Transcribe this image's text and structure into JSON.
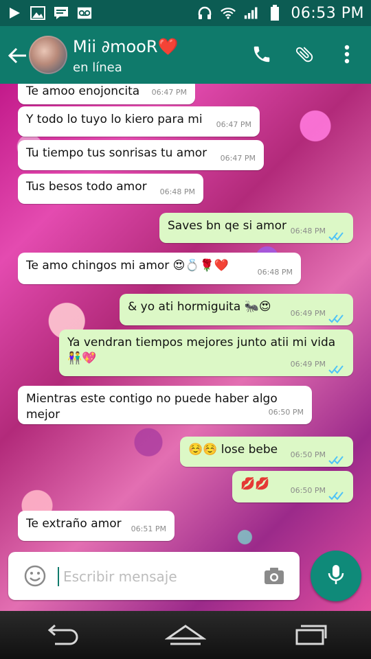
{
  "status_bar": {
    "time": "06:53 PM",
    "icons": [
      "play-icon",
      "image-icon",
      "message-icon",
      "voicemail-icon",
      "headphones-icon",
      "wifi-icon",
      "signal-icon",
      "battery-icon"
    ]
  },
  "header": {
    "contact_name": "Mii ∂mooR❤️",
    "status": "en línea",
    "icons": [
      "back-arrow-icon",
      "phone-icon",
      "attach-icon",
      "more-vert-icon"
    ]
  },
  "messages": [
    {
      "dir": "in",
      "text": "Te amoo enojoncita",
      "time": "06:47 PM"
    },
    {
      "dir": "in",
      "text": "Y todo lo tuyo lo kiero para mi",
      "time": "06:47 PM"
    },
    {
      "dir": "in",
      "text": "Tu tiempo tus sonrisas tu amor",
      "time": "06:47 PM"
    },
    {
      "dir": "in",
      "text": "Tus besos todo amor",
      "time": "06:48 PM"
    },
    {
      "dir": "out",
      "text": "Saves bn qe si amor",
      "time": "06:48 PM"
    },
    {
      "dir": "in",
      "text": "Te amo chingos mi amor 😍💍🌹❤️",
      "time": "06:48 PM"
    },
    {
      "dir": "out",
      "text": "& yo ati hormiguita 🐜😍",
      "time": "06:49 PM"
    },
    {
      "dir": "out",
      "text": "Ya vendran tiempos mejores junto atii mi vida 👫💖",
      "time": "06:49 PM"
    },
    {
      "dir": "in",
      "text": "Mientras este contigo no puede haber algo mejor",
      "time": "06:50 PM"
    },
    {
      "dir": "out",
      "text": "☺️☺️ lose bebe",
      "time": "06:50 PM"
    },
    {
      "dir": "out",
      "text": "💋💋",
      "time": "06:50 PM"
    },
    {
      "dir": "in",
      "text": "Te extraño amor",
      "time": "06:51 PM"
    }
  ],
  "composer": {
    "placeholder": "Escribir mensaje"
  },
  "colors": {
    "status_bar": "#0c5c53",
    "app_bar": "#0f7a6b",
    "outgoing_bubble": "#dcf8c6",
    "incoming_bubble": "#ffffff",
    "read_ticks": "#4fc3f7",
    "mic_button": "#0f8a79"
  }
}
